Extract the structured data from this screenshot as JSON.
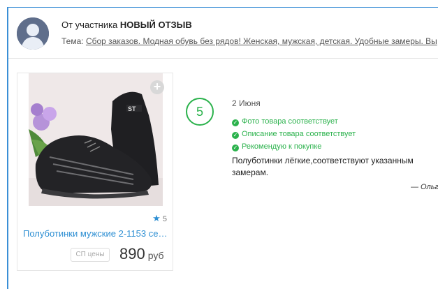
{
  "header": {
    "from_prefix": "От участника",
    "from_title": "НОВЫЙ ОТЗЫВ",
    "topic_label": "Тема:",
    "topic_link": "Сбор заказов. Модная обувь без рядов! Женская, мужская, детская. Удобные замеры. Вы"
  },
  "product": {
    "rating": "5",
    "title": "Полуботинки мужские 2-1153 се…",
    "sp_badge": "СП цены",
    "price": "890",
    "currency": "руб"
  },
  "review": {
    "score": "5",
    "date": "2 Июня",
    "checks": [
      "Фото товара соответствует",
      "Описание товара соответствует",
      "Рекомендую к покупке"
    ],
    "text": "Полуботинки лёгкие,соответствуют указанным замерам.",
    "author": "— Ольга"
  },
  "colors": {
    "accent_blue": "#2e8fd3",
    "green": "#2bb24c",
    "frame": "#3a8fd6"
  },
  "icons": {
    "avatar": "user-avatar-placeholder",
    "rating": "star-icon",
    "add": "plus-icon",
    "check": "check-circle-icon"
  }
}
